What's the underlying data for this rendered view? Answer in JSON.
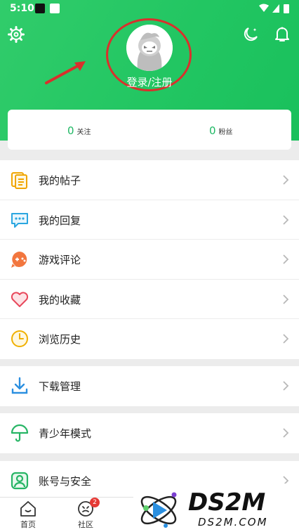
{
  "status_bar": {
    "time": "5:10"
  },
  "header": {
    "login_label": "登录/注册"
  },
  "stats": [
    {
      "count": "0",
      "label": "关注"
    },
    {
      "count": "0",
      "label": "粉丝"
    }
  ],
  "menu_group1": [
    {
      "label": "我的帖子",
      "icon": "posts-icon"
    },
    {
      "label": "我的回复",
      "icon": "reply-icon"
    },
    {
      "label": "游戏评论",
      "icon": "game-comment-icon"
    },
    {
      "label": "我的收藏",
      "icon": "heart-icon"
    },
    {
      "label": "浏览历史",
      "icon": "clock-icon"
    }
  ],
  "menu_group2": [
    {
      "label": "下载管理",
      "icon": "download-icon"
    }
  ],
  "menu_group3": [
    {
      "label": "青少年模式",
      "icon": "umbrella-icon"
    }
  ],
  "menu_group4": [
    {
      "label": "账号与安全",
      "icon": "account-icon"
    }
  ],
  "bottom_nav": {
    "home_label": "首页",
    "community_label": "社区",
    "community_badge": "2"
  },
  "watermark": {
    "brand": "DS2M",
    "site": "DS2M.COM"
  },
  "colors": {
    "accent": "#22c662",
    "highlight": "#d9302c",
    "badge": "#e53935"
  }
}
